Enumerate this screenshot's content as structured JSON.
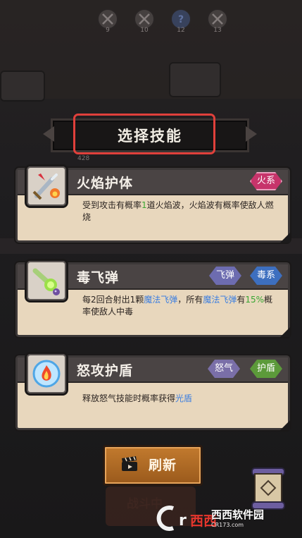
{
  "title": "选择技能",
  "stage_numbers": [
    "9",
    "10",
    "12",
    "13"
  ],
  "level_tag": "428",
  "skills": [
    {
      "name": "火焰护体",
      "tags": [
        "火系"
      ],
      "desc_parts": [
        {
          "t": "受到攻击有概率"
        },
        {
          "t": "1",
          "c": "green"
        },
        {
          "t": "道火焰波，火焰波有概率使敌人燃烧"
        }
      ],
      "icon": "flaming-sword-icon"
    },
    {
      "name": "毒飞弹",
      "tags": [
        "飞弹",
        "毒系"
      ],
      "desc_parts": [
        {
          "t": "每2回合射出1颗"
        },
        {
          "t": "魔法飞弹",
          "c": "blue"
        },
        {
          "t": "，所有"
        },
        {
          "t": "魔法飞弹",
          "c": "blue"
        },
        {
          "t": "有"
        },
        {
          "t": "15%",
          "c": "green"
        },
        {
          "t": "概率使敌人中毒"
        }
      ],
      "icon": "poison-missile-icon"
    },
    {
      "name": "怒攻护盾",
      "tags": [
        "怒气",
        "护盾"
      ],
      "desc_parts": [
        {
          "t": "释放怒气技能时概率获得"
        },
        {
          "t": "光盾",
          "c": "blue"
        }
      ],
      "icon": "fire-shield-icon"
    }
  ],
  "refresh_label": "刷新",
  "fight_label": "战斗中",
  "watermark": {
    "brand": "西西软件园",
    "site": "CR173.com"
  },
  "colors": {
    "accent_red": "#e0403b",
    "card_bg": "#e8d7bd",
    "button": "#c27a2e"
  }
}
